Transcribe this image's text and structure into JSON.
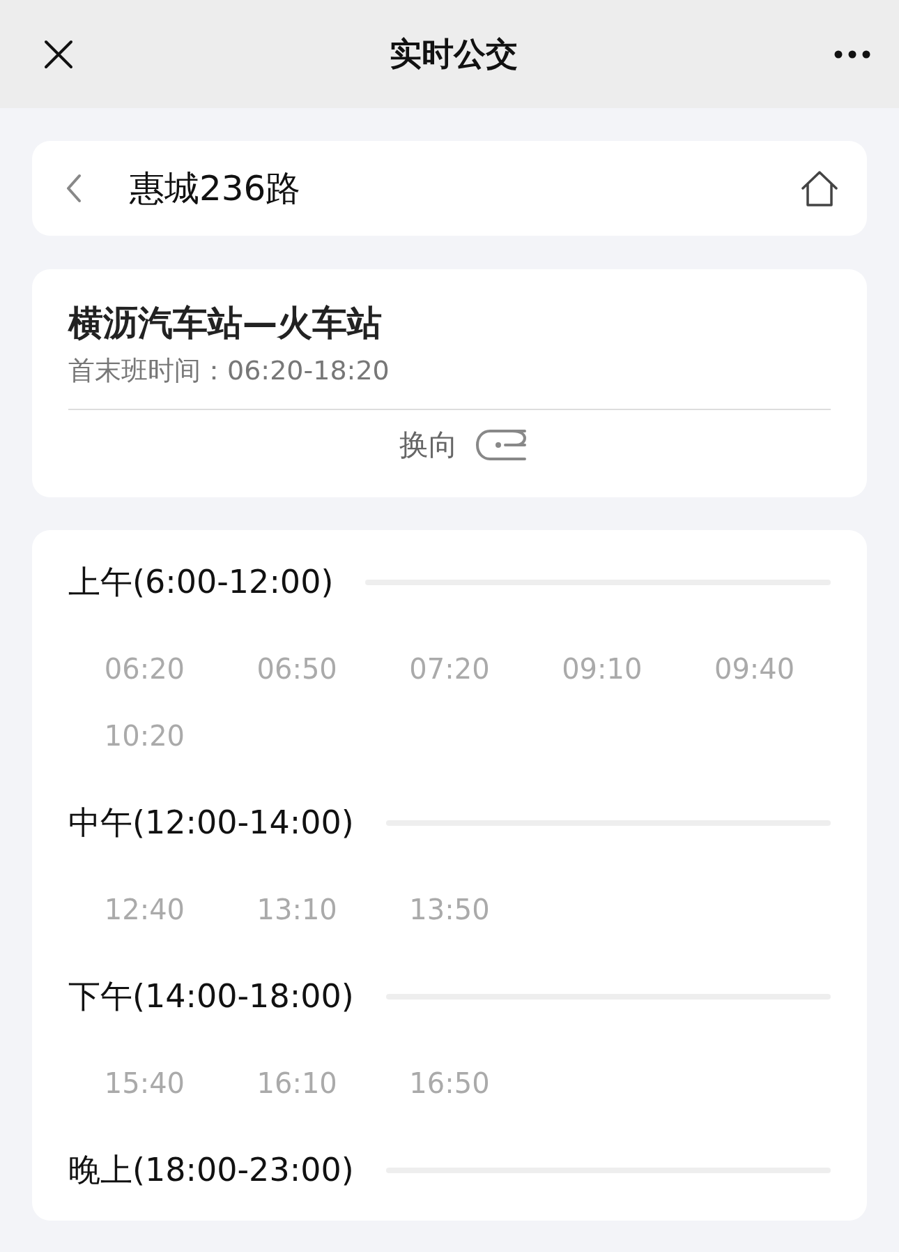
{
  "header": {
    "title": "实时公交"
  },
  "route": {
    "name": "惠城236路"
  },
  "direction": {
    "title": "横沥汽车站—火车站",
    "hours_label": "首末班时间：",
    "hours": "06:20-18:20",
    "switch_label": "换向"
  },
  "periods": [
    {
      "label": "上午(6:00-12:00)",
      "times": [
        "06:20",
        "06:50",
        "07:20",
        "09:10",
        "09:40",
        "10:20"
      ]
    },
    {
      "label": "中午(12:00-14:00)",
      "times": [
        "12:40",
        "13:10",
        "13:50"
      ]
    },
    {
      "label": "下午(14:00-18:00)",
      "times": [
        "15:40",
        "16:10",
        "16:50"
      ]
    },
    {
      "label": "晚上(18:00-23:00)"
    }
  ]
}
